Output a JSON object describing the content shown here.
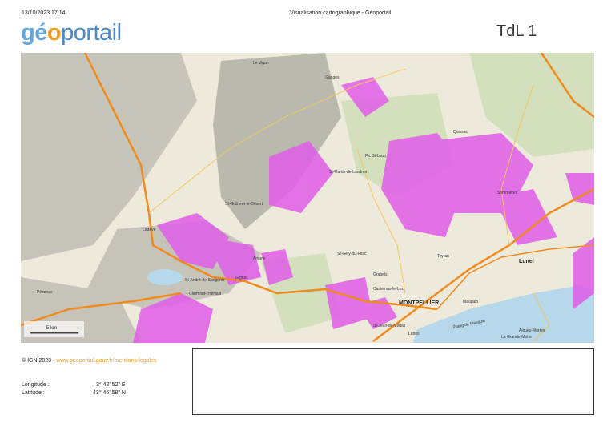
{
  "header": {
    "date": "13/10/2023 17:14",
    "title": "Visualisation cartographique - Géoportail",
    "logo": "géoportail",
    "print_title": "TdL 1"
  },
  "map": {
    "scale_label": "5 km",
    "places": [
      "Le Vigan",
      "Ganges",
      "St-Martin-de-Londres",
      "Lodève",
      "Clermont-l'Hérault",
      "Gignac",
      "St-André-de-Sangonis",
      "Aniane",
      "St-Guilhem-le-Désert",
      "Pic St-Loup",
      "Sommières",
      "Lunel",
      "Castelnau-le-Lez",
      "MONTPELLIER",
      "Mauguio",
      "St-Jean-de-Védas",
      "Lattes",
      "Aigues-Mortes",
      "La Grande-Motte",
      "Étang de Mauguio",
      "Grabels",
      "Teyran",
      "Quissac",
      "St-Gély-du-Fesc",
      "Pézenas"
    ],
    "colors": {
      "zone": "#e05de8",
      "road": "#f08a1c",
      "water": "#b7d7ea",
      "relief": "#a9a9a0"
    }
  },
  "footer": {
    "copyright": "© IGN 2023 - ",
    "link": "www.geoportail.gouv.fr/mentions-legales",
    "longitude_label": "Longitude :",
    "longitude_value": "3° 42' 52\" E",
    "latitude_label": "Latitude :",
    "latitude_value": "43° 46' 58\" N"
  }
}
